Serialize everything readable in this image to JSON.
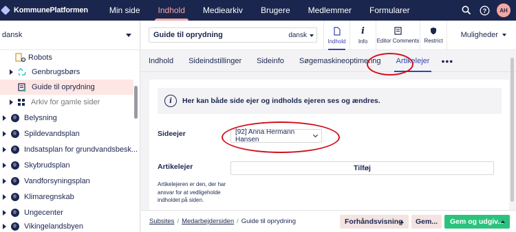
{
  "topbar": {
    "logo": "KommunePlatformen",
    "nav": [
      "Min side",
      "Indhold",
      "Mediearkiv",
      "Brugere",
      "Medlemmer",
      "Formularer"
    ],
    "active_nav": "Indhold",
    "avatar_initials": "AH"
  },
  "tree": {
    "language": "dansk",
    "items": [
      {
        "label": "Robots",
        "icon": "robots-icon"
      },
      {
        "label": "Genbrugsbørs",
        "icon": "recycle-icon"
      },
      {
        "label": "Guide til oprydning",
        "icon": "page-icon",
        "selected": true
      },
      {
        "label": "Arkiv for gamle sider",
        "icon": "grid-icon"
      },
      {
        "label": "Belysning",
        "icon": "globe-icon"
      },
      {
        "label": "Spildevandsplan",
        "icon": "globe-icon"
      },
      {
        "label": "Indsatsplan for grundvandsbesk...",
        "icon": "globe-icon"
      },
      {
        "label": "Skybrudsplan",
        "icon": "globe-icon"
      },
      {
        "label": "Vandforsyningsplan",
        "icon": "globe-icon"
      },
      {
        "label": "Klimaregnskab",
        "icon": "globe-icon"
      },
      {
        "label": "Ungecenter",
        "icon": "globe-icon"
      },
      {
        "label": "Vikingelandsbyen",
        "icon": "globe-icon"
      }
    ]
  },
  "editor": {
    "page_name": "Guide til oprydning",
    "language": "dansk",
    "apps": [
      {
        "label": "Indhold",
        "icon": "document-icon"
      },
      {
        "label": "Info",
        "icon": "info-icon"
      },
      {
        "label": "Editor Comments",
        "icon": "comments-icon"
      },
      {
        "label": "Restrict",
        "icon": "shield-icon"
      }
    ],
    "options_label": "Muligheder"
  },
  "tabs": [
    "Indhold",
    "Sideindstillinger",
    "Sideinfo",
    "Søgemaskineoptimering",
    "Artikelejer"
  ],
  "active_tab": "Artikelejer",
  "card": {
    "info_text": "Her kan både side ejer og indholds ejeren ses og ændres.",
    "owner_label": "Sideejer",
    "owner_value": "[92] Anna Hermann Hansen",
    "article_owner_label": "Artikelejer",
    "add_button": "Tilføj",
    "description": "Artikelejeren er den, der har ansvar for at vedligeholde indholdet på siden."
  },
  "footer": {
    "breadcrumb": [
      "Subsites",
      "Medarbejdersiden",
      "Guide til oprydning"
    ],
    "preview_label": "Forhåndsvisning",
    "save_label": "Gem...",
    "publish_label": "Gem og udgiv..."
  },
  "colors": {
    "navy": "#1b264f",
    "accent_pink": "#f5a7a1",
    "active_blue": "#3544b1",
    "publish_green": "#2bc37c",
    "annotation_red": "#d0101a"
  }
}
